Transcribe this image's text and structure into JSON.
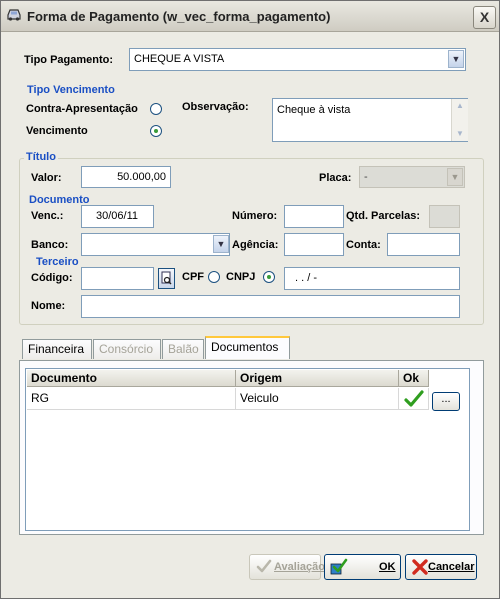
{
  "window": {
    "title": "Forma de Pagamento (w_vec_forma_pagamento)",
    "close_glyph": "X"
  },
  "tipo_pagamento": {
    "label": "Tipo Pagamento:",
    "value": "CHEQUE A VISTA"
  },
  "tipo_vencimento": {
    "section": "Tipo Vencimento",
    "options": [
      {
        "label": "Contra-Apresentação",
        "checked": false
      },
      {
        "label": "Vencimento",
        "checked": true
      }
    ]
  },
  "observacao": {
    "label": "Observação:",
    "value": "Cheque à vista"
  },
  "titulo": {
    "section": "Título",
    "valor_label": "Valor:",
    "valor": "50.000,00",
    "placa_label": "Placa:",
    "placa": "-"
  },
  "documento": {
    "section": "Documento",
    "venc_label": "Venc.:",
    "venc": "30/06/11",
    "numero_label": "Número:",
    "numero": "",
    "qtd_parcelas_label": "Qtd. Parcelas:",
    "qtd_parcelas": "",
    "banco_label": "Banco:",
    "banco": "",
    "agencia_label": "Agência:",
    "agencia": "",
    "conta_label": "Conta:",
    "conta": ""
  },
  "terceiro": {
    "section": "Terceiro",
    "codigo_label": "Código:",
    "codigo": "",
    "cpf_label": "CPF",
    "cnpj_label": "CNPJ",
    "cpf_checked": false,
    "cnpj_checked": true,
    "documento_mask": ". . /  -",
    "nome_label": "Nome:",
    "nome": ""
  },
  "tabs": [
    {
      "label": "Financeira",
      "state": "normal"
    },
    {
      "label": "Consórcio",
      "state": "disabled"
    },
    {
      "label": "Balão",
      "state": "disabled"
    },
    {
      "label": "Documentos",
      "state": "active"
    }
  ],
  "docs_table": {
    "headers": [
      "Documento",
      "Origem",
      "Ok"
    ],
    "rows": [
      {
        "documento": "RG",
        "origem": "Veiculo",
        "ok": true,
        "action": "..."
      }
    ]
  },
  "buttons": {
    "avaliacao": "Avaliação",
    "ok": "OK",
    "cancelar": "Cancelar"
  },
  "colors": {
    "section_title": "#1a4fc4",
    "check_green": "#2f9e1f",
    "cancel_red": "#d12b1f",
    "active_tab": "#ffc83c"
  }
}
